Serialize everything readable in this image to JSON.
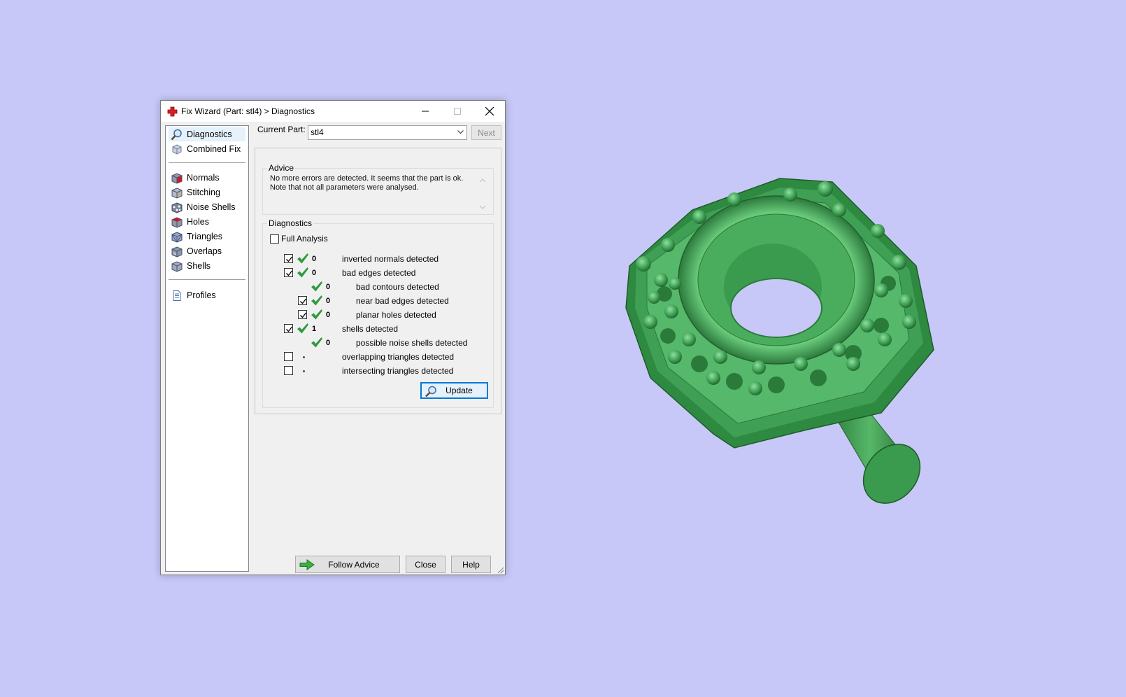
{
  "window": {
    "title": "Fix Wizard (Part: stl4) > Diagnostics",
    "title_icon": "red-cross-icon"
  },
  "nav": {
    "items": [
      {
        "label": "Diagnostics",
        "icon": "magnifier-icon",
        "selected": true
      },
      {
        "label": "Combined Fix",
        "icon": "cube-icon"
      },
      {
        "label": "Normals",
        "icon": "normals-cube-icon"
      },
      {
        "label": "Stitching",
        "icon": "stitching-cube-icon"
      },
      {
        "label": "Noise Shells",
        "icon": "noise-shells-icon"
      },
      {
        "label": "Holes",
        "icon": "holes-cube-icon"
      },
      {
        "label": "Triangles",
        "icon": "triangles-cube-icon"
      },
      {
        "label": "Overlaps",
        "icon": "overlaps-cube-icon"
      },
      {
        "label": "Shells",
        "icon": "shells-cube-icon"
      },
      {
        "label": "Profiles",
        "icon": "profiles-document-icon"
      }
    ]
  },
  "toolbar": {
    "current_part_label": "Current Part:",
    "current_part_value": "stl4",
    "next_label": "Next"
  },
  "advice": {
    "title": "Advice",
    "text_line1": "No more errors are detected. It seems that the part is ok.",
    "text_line2": "Note that not all parameters were analysed."
  },
  "diagnostics": {
    "title": "Diagnostics",
    "full_analysis_label": "Full Analysis",
    "full_analysis_checked": false,
    "rows": [
      {
        "checkbox": true,
        "checked": true,
        "status": "ok",
        "count": "0",
        "label": "inverted normals detected",
        "indent": 0
      },
      {
        "checkbox": true,
        "checked": true,
        "status": "ok",
        "count": "0",
        "label": "bad edges detected",
        "indent": 0
      },
      {
        "checkbox": false,
        "status": "ok",
        "count": "0",
        "label": "bad contours detected",
        "indent": 1
      },
      {
        "checkbox": true,
        "checked": true,
        "status": "ok",
        "count": "0",
        "label": "near bad edges detected",
        "indent": 1
      },
      {
        "checkbox": true,
        "checked": true,
        "status": "ok",
        "count": "0",
        "label": "planar holes detected",
        "indent": 1
      },
      {
        "checkbox": true,
        "checked": true,
        "status": "ok",
        "count": "1",
        "label": "shells detected",
        "indent": 0
      },
      {
        "checkbox": false,
        "status": "ok",
        "count": "0",
        "label": "possible noise shells detected",
        "indent": 1
      },
      {
        "checkbox": true,
        "checked": false,
        "status": "none",
        "count": "",
        "label": "overlapping triangles detected",
        "indent": 0
      },
      {
        "checkbox": true,
        "checked": false,
        "status": "none",
        "count": "",
        "label": "intersecting triangles detected",
        "indent": 0
      }
    ],
    "update_label": "Update"
  },
  "footer": {
    "follow_advice_label": "Follow Advice",
    "close_label": "Close",
    "help_label": "Help"
  },
  "colors": {
    "background": "#c8c8f8",
    "check_green": "#2e9a3e",
    "model_green": "#3fa055",
    "accent_blue": "#0078d7"
  }
}
